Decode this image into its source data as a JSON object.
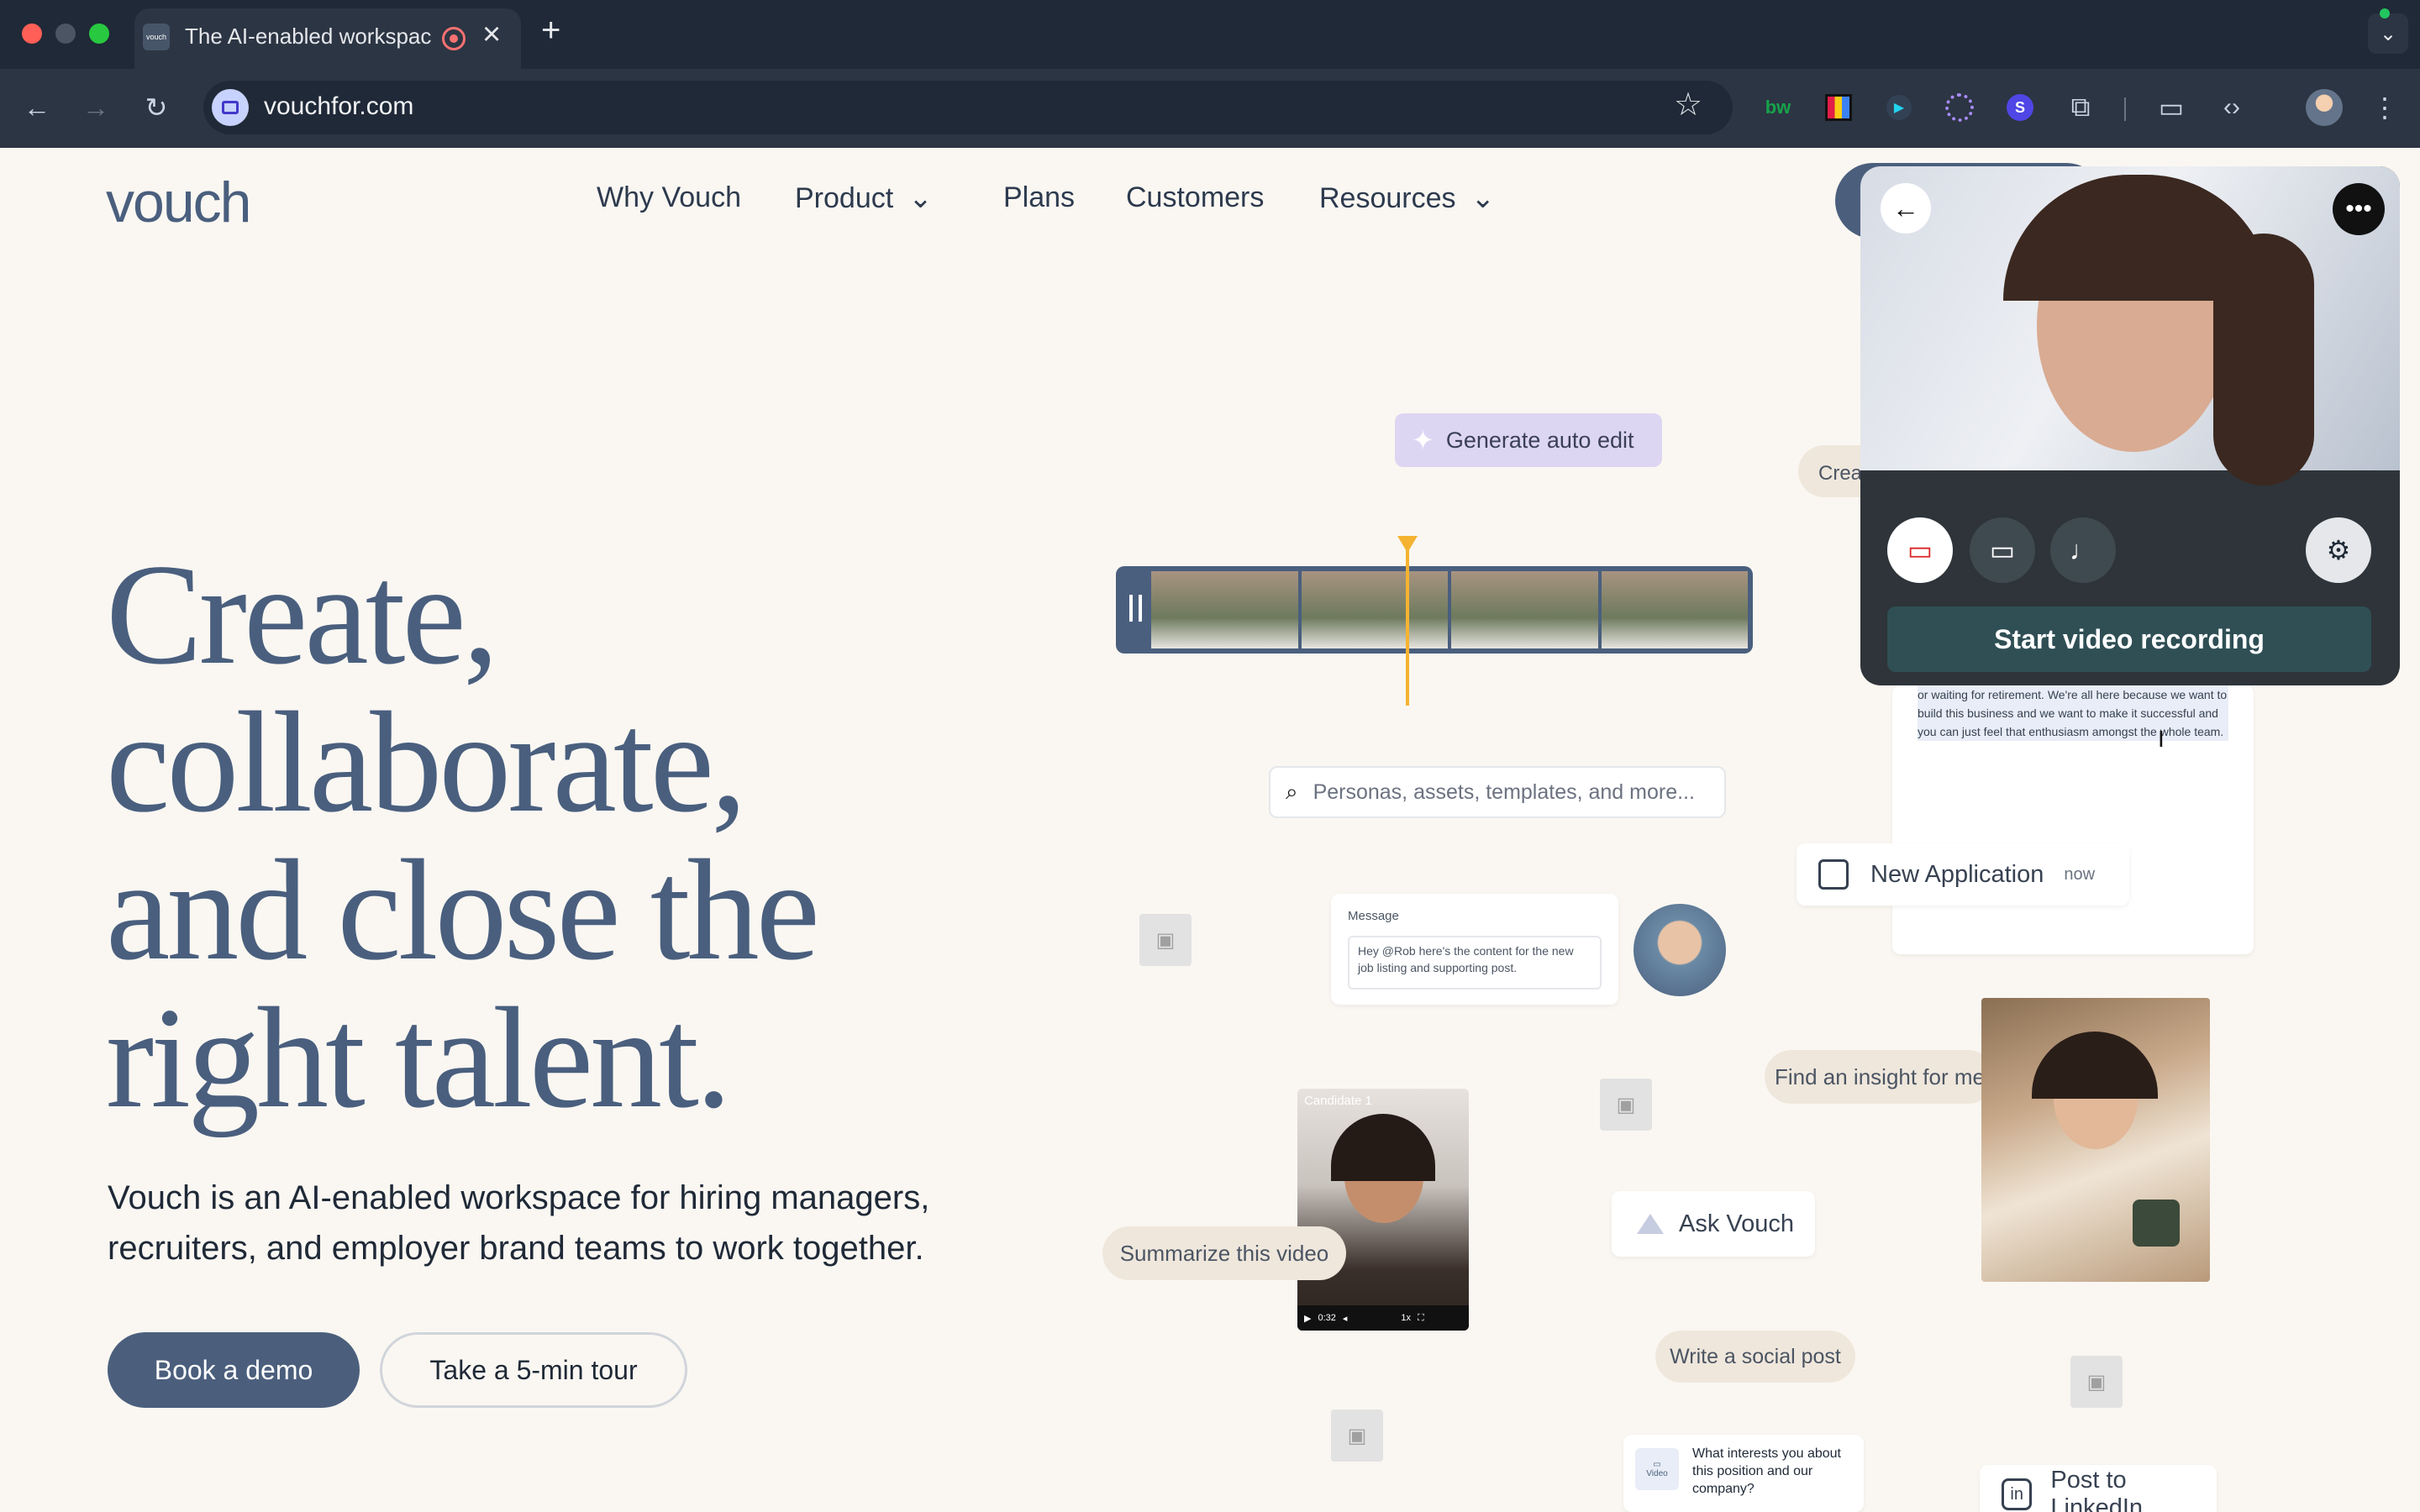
{
  "browser": {
    "tab_title": "The AI-enabled workspac",
    "tab_favicon": "vouch",
    "url": "vouchfor.com",
    "new_tab": "+",
    "close": "×",
    "ext_bw": "bw",
    "ext_s": "S"
  },
  "nav": {
    "logo": "vouch",
    "items": [
      "Why Vouch",
      "Product",
      "Plans",
      "Customers",
      "Resources"
    ]
  },
  "hero": {
    "lines": [
      "Create,",
      "collaborate,",
      "and close the",
      "right talent."
    ],
    "subtitle_line1": "Vouch is an AI-enabled workspace for hiring managers,",
    "subtitle_line2": "recruiters, and employer brand teams to work together.",
    "cta_primary": "Book a demo",
    "cta_secondary": "Take a 5-min tour"
  },
  "collage": {
    "generate_btn": "Generate auto edit",
    "search_placeholder": "Personas, assets, templates, and more...",
    "message_label": "Message",
    "message_text": "Hey @Rob here's the content for the new job listing and supporting post.",
    "new_application": "New Application",
    "new_application_time": "now",
    "find_insight": "Find an insight for me",
    "candidate_label": "Candidate 1",
    "summarize": "Summarize this video",
    "ask_vouch": "Ask Vouch",
    "write_social": "Write a social post",
    "question_text": "What interests you about this position and our company?",
    "video_label": "Video",
    "post_linkedin": "Post to LinkedIn",
    "transcript": "or waiting for retirement. We're all here because we want to build this business and we want to make it successful and you can just feel that enthusiasm amongst the whole team.",
    "create_partial": "Crea",
    "video_time": "0:32",
    "video_speed": "1x"
  },
  "recorder": {
    "start_label": "Start video recording"
  },
  "colors": {
    "brand": "#4a5f7e",
    "primary_button": "#4b5f7d",
    "recorder_bg": "#2e3439",
    "record_button": "#2f4f55",
    "generate_bg": "#ddd6f3"
  }
}
